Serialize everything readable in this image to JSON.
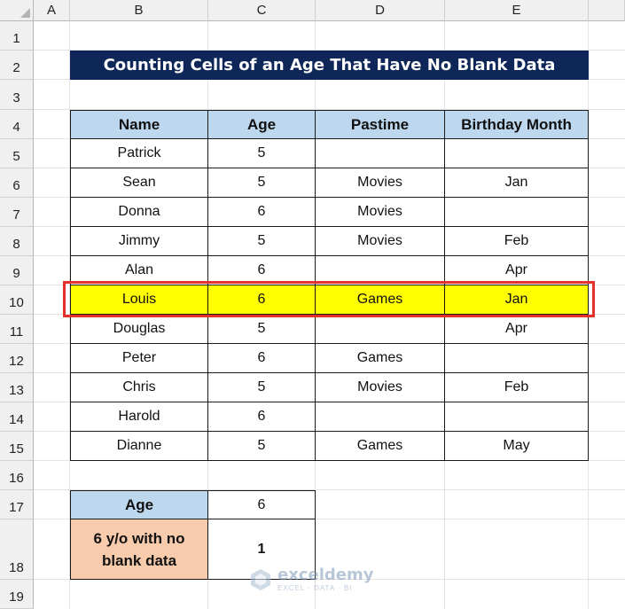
{
  "columns": [
    "A",
    "B",
    "C",
    "D",
    "E"
  ],
  "rows": [
    "1",
    "2",
    "3",
    "4",
    "5",
    "6",
    "7",
    "8",
    "9",
    "10",
    "11",
    "12",
    "13",
    "14",
    "15",
    "16",
    "17",
    "18",
    "19"
  ],
  "title": "Counting Cells of an Age That Have No Blank Data",
  "table": {
    "headers": [
      "Name",
      "Age",
      "Pastime",
      "Birthday Month"
    ],
    "rows": [
      [
        "Patrick",
        "5",
        "",
        ""
      ],
      [
        "Sean",
        "5",
        "Movies",
        "Jan"
      ],
      [
        "Donna",
        "6",
        "Movies",
        ""
      ],
      [
        "Jimmy",
        "5",
        "Movies",
        "Feb"
      ],
      [
        "Alan",
        "6",
        "",
        "Apr"
      ],
      [
        "Louis",
        "6",
        "Games",
        "Jan"
      ],
      [
        "Douglas",
        "5",
        "",
        "Apr"
      ],
      [
        "Peter",
        "6",
        "Games",
        ""
      ],
      [
        "Chris",
        "5",
        "Movies",
        "Feb"
      ],
      [
        "Harold",
        "6",
        "",
        ""
      ],
      [
        "Dianne",
        "5",
        "Games",
        "May"
      ]
    ],
    "highlighted_row_index": 5
  },
  "summary": {
    "age_label": "Age",
    "age_value": "6",
    "result_label_line1": "6 y/o with no",
    "result_label_line2": "blank data",
    "result_value": "1"
  },
  "watermark": {
    "name": "exceldemy",
    "sub": "EXCEL · DATA · BI"
  },
  "colors": {
    "title_bg": "#0e2758",
    "header_bg": "#bdd7ee",
    "highlight_bg": "#ffff00",
    "result_label_bg": "#f8cbad",
    "selection_outline": "#e4312b"
  }
}
